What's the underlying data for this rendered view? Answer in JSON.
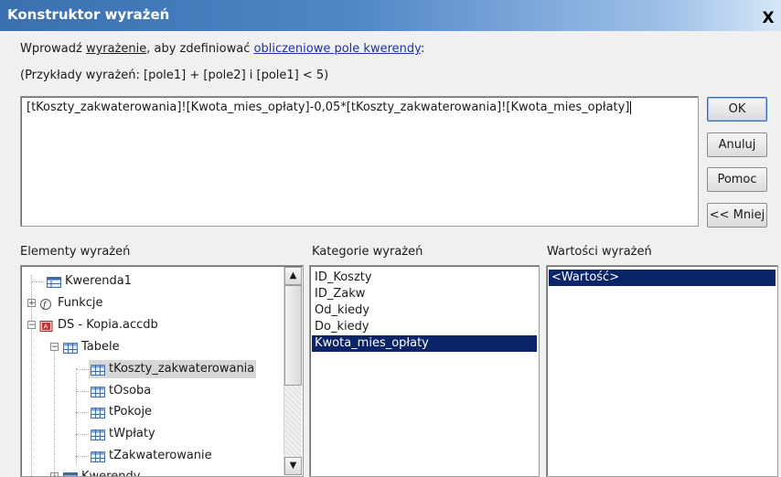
{
  "dialog": {
    "title": "Konstruktor wyrażeń",
    "close_symbol": "X"
  },
  "instructions": {
    "prefix": "Wprowadź ",
    "underlined_word": "wyrażenie",
    "middle": ", aby zdefiniować ",
    "link": "obliczeniowe pole kwerendy",
    "suffix": ":",
    "examples": "(Przykłady wyrażeń: [pole1] + [pole2] i [pole1] < 5)"
  },
  "expression": {
    "value": "[tKoszty_zakwaterowania]![Kwota_mies_opłaty]-0,05*[tKoszty_zakwaterowania]![Kwota_mies_opłaty]"
  },
  "buttons": {
    "ok": "OK",
    "cancel": "Anuluj",
    "help": "Pomoc",
    "less": "<< Mniej"
  },
  "labels": {
    "elements": "Elementy wyrażeń",
    "categories": "Kategorie wyrażeń",
    "values": "Wartości wyrażeń"
  },
  "tree": [
    {
      "label": "Kwerenda1",
      "icon": "query-icon"
    },
    {
      "label": "Funkcje",
      "icon": "function-icon",
      "expander": "+"
    },
    {
      "label": "DS - Kopia.accdb",
      "icon": "access-db-icon",
      "expander": "−"
    },
    {
      "label": "Tabele",
      "icon": "table-icon",
      "expander": "−"
    },
    {
      "label": "tKoszty_zakwaterowania",
      "icon": "table-icon",
      "selected": true
    },
    {
      "label": "tOsoba",
      "icon": "table-icon"
    },
    {
      "label": "tPokoje",
      "icon": "table-icon"
    },
    {
      "label": "tWpłaty",
      "icon": "table-icon"
    },
    {
      "label": "tZakwaterowanie",
      "icon": "table-icon"
    },
    {
      "label": "Kwerendy",
      "icon": "query-icon",
      "expander": "+"
    }
  ],
  "categories": [
    {
      "label": "ID_Koszty"
    },
    {
      "label": "ID_Zakw"
    },
    {
      "label": "Od_kiedy"
    },
    {
      "label": "Do_kiedy"
    },
    {
      "label": "Kwota_mies_opłaty",
      "selected": true
    }
  ],
  "values": [
    {
      "label": "<Wartość>",
      "selected": true
    }
  ],
  "colors": {
    "selection": "#0a246a",
    "link": "#1a33a6",
    "title_bar": "#4f86c6"
  }
}
